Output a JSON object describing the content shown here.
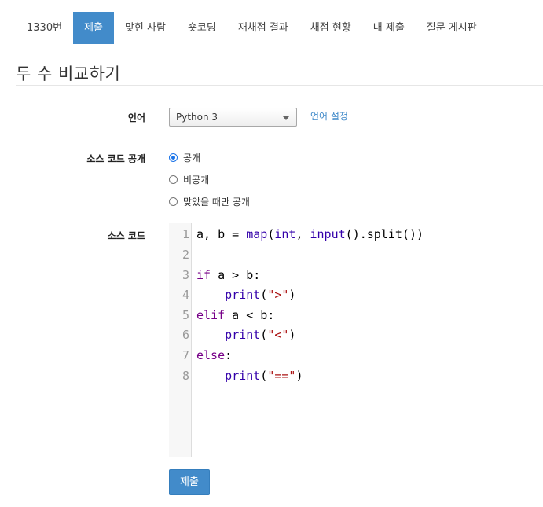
{
  "nav": {
    "tabs": [
      {
        "label": "1330번",
        "active": false
      },
      {
        "label": "제출",
        "active": true
      },
      {
        "label": "맞힌 사람",
        "active": false
      },
      {
        "label": "숏코딩",
        "active": false
      },
      {
        "label": "재채점 결과",
        "active": false
      },
      {
        "label": "채점 현황",
        "active": false
      },
      {
        "label": "내 제출",
        "active": false
      },
      {
        "label": "질문 게시판",
        "active": false
      }
    ]
  },
  "page": {
    "title": "두 수 비교하기"
  },
  "form": {
    "language_label": "언어",
    "language_value": "Python 3",
    "language_settings_link": "언어 설정",
    "visibility_label": "소스 코드 공개",
    "visibility_options": [
      {
        "label": "공개",
        "checked": true
      },
      {
        "label": "비공개",
        "checked": false
      },
      {
        "label": "맞았을 때만 공개",
        "checked": false
      }
    ],
    "source_label": "소스 코드",
    "code_lines": [
      "a, b = map(int, input().split())",
      "",
      "if a > b:",
      "    print(\">\")",
      "elif a < b:",
      "    print(\"<\")",
      "else:",
      "    print(\"==\")"
    ],
    "line_numbers": [
      "1",
      "2",
      "3",
      "4",
      "5",
      "6",
      "7",
      "8"
    ],
    "submit_label": "제출"
  },
  "colors": {
    "accent": "#428bca",
    "keyword": "#770088",
    "string": "#aa1111",
    "builtin": "#3300aa"
  }
}
